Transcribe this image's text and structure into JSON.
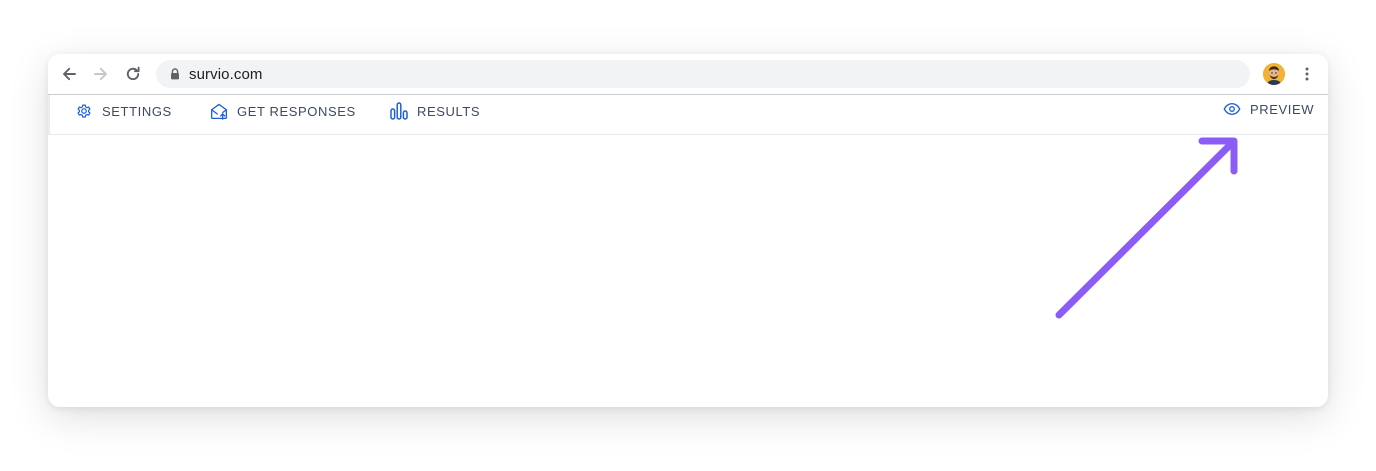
{
  "browser": {
    "url": "survio.com",
    "icons": {
      "back": "arrow-left-icon",
      "forward": "arrow-right-icon",
      "reload": "reload-icon",
      "lock": "lock-icon",
      "menu": "kebab-menu-icon"
    }
  },
  "app_nav": {
    "settings_label": "SETTINGS",
    "get_responses_label": "GET RESPONSES",
    "results_label": "RESULTS",
    "preview_label": "PREVIEW",
    "icons": {
      "settings": "gear-icon",
      "get_responses": "envelope-upload-icon",
      "results": "bar-chart-icon",
      "preview": "eye-icon"
    }
  },
  "annotation": {
    "type": "arrow",
    "points_to": "preview",
    "color": "#8b5cf6"
  },
  "colors": {
    "accent_icon": "#1f5fdc",
    "nav_text": "#3c4a63",
    "omnibox_bg": "#f1f3f4",
    "annotation_arrow": "#8b5cf6"
  }
}
